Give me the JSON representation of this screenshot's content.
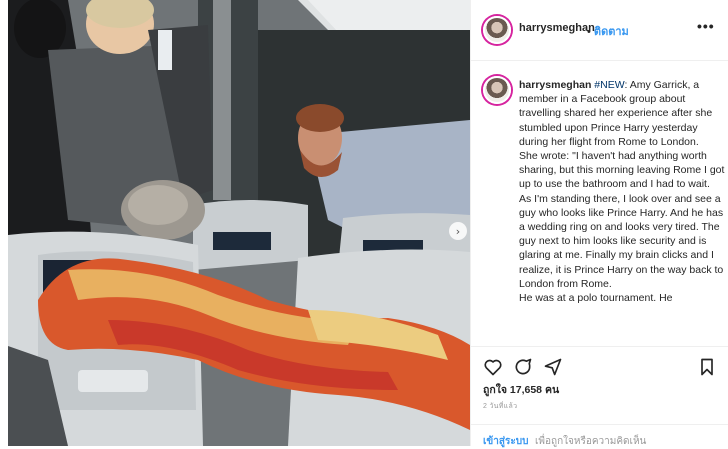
{
  "post": {
    "username": "harrysmeghan",
    "separator": "•",
    "follow_label": "ติดตาม",
    "more_label": "•••",
    "caption_user": "harrysmeghan",
    "caption_tag": "#NEW",
    "caption_lines": [
      ": Amy Garrick, a member in a Facebook group about travelling shared her experience after she stumbled upon Prince Harry yesterday during her flight from Rome to London.",
      "She wrote: \"I haven't had anything worth sharing, but this morning leaving Rome I got up to use the bathroom and I had to wait.",
      "As I'm standing there, I look over and see a guy who looks like Prince Harry. And he has a wedding ring on and looks very tired. The guy next to him looks like security and is glaring at me. Finally my brain clicks and I realize, it is Prince Harry on the way back to London from Rome.",
      "He was at a polo tournament. He"
    ],
    "likes_label": "ถูกใจ 17,658 คน",
    "time_ago": "2 วันที่แล้ว",
    "login_link": "เข้าสู่ระบบ",
    "login_text": "เพื่อถูกใจหรือความคิดเห็น",
    "carousel_next": "›"
  },
  "icons": {
    "like": "heart-icon",
    "comment": "comment-icon",
    "share": "share-icon",
    "save": "bookmark-icon"
  },
  "colors": {
    "link_blue": "#3897f0",
    "text": "#262626",
    "muted": "#999999",
    "border": "#efefef"
  }
}
